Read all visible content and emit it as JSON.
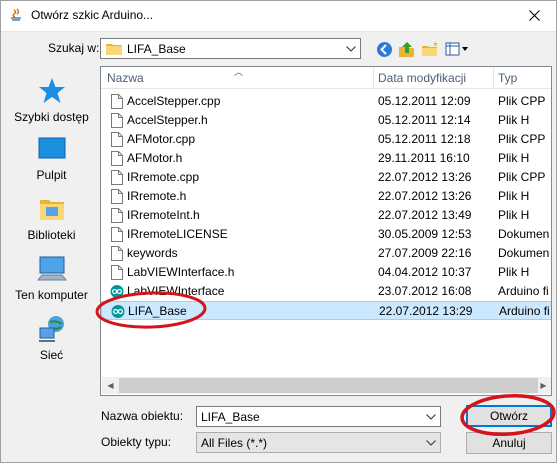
{
  "window": {
    "title": "Otwórz szkic Arduino..."
  },
  "toolbar": {
    "look_in_label": "Szukaj w:",
    "look_in_value": "LIFA_Base",
    "icons": [
      "back-icon",
      "up-folder-icon",
      "new-folder-icon",
      "view-menu-icon"
    ]
  },
  "places": [
    {
      "label": "Szybki dostęp",
      "icon": "star-icon"
    },
    {
      "label": "Pulpit",
      "icon": "desktop-icon"
    },
    {
      "label": "Biblioteki",
      "icon": "libraries-icon"
    },
    {
      "label": "Ten komputer",
      "icon": "computer-icon"
    },
    {
      "label": "Sieć",
      "icon": "network-icon"
    }
  ],
  "filelist": {
    "columns": {
      "name": "Nazwa",
      "date": "Data modyfikacji",
      "type": "Typ"
    },
    "rows": [
      {
        "name": "AccelStepper.cpp",
        "date": "05.12.2011 12:09",
        "type": "Plik CPP",
        "icon": "file-icon"
      },
      {
        "name": "AccelStepper.h",
        "date": "05.12.2011 12:14",
        "type": "Plik H",
        "icon": "file-icon"
      },
      {
        "name": "AFMotor.cpp",
        "date": "05.12.2011 12:18",
        "type": "Plik CPP",
        "icon": "file-icon"
      },
      {
        "name": "AFMotor.h",
        "date": "29.11.2011 16:10",
        "type": "Plik H",
        "icon": "file-icon"
      },
      {
        "name": "IRremote.cpp",
        "date": "22.07.2012 13:26",
        "type": "Plik CPP",
        "icon": "file-icon"
      },
      {
        "name": "IRremote.h",
        "date": "22.07.2012 13:26",
        "type": "Plik H",
        "icon": "file-icon"
      },
      {
        "name": "IRremoteInt.h",
        "date": "22.07.2012 13:49",
        "type": "Plik H",
        "icon": "file-icon"
      },
      {
        "name": "IRremoteLICENSE",
        "date": "30.05.2009 12:53",
        "type": "Dokumen",
        "icon": "file-icon"
      },
      {
        "name": "keywords",
        "date": "27.07.2009 22:16",
        "type": "Dokumen",
        "icon": "file-icon"
      },
      {
        "name": "LabVIEWInterface.h",
        "date": "04.04.2012 10:37",
        "type": "Plik H",
        "icon": "file-icon"
      },
      {
        "name": "LabVIEWInterface",
        "date": "23.07.2012 16:08",
        "type": "Arduino fi",
        "icon": "arduino-icon"
      },
      {
        "name": "LIFA_Base",
        "date": "22.07.2012 13:29",
        "type": "Arduino fi",
        "icon": "arduino-icon",
        "selected": true
      }
    ]
  },
  "form": {
    "object_name_label": "Nazwa obiektu:",
    "object_name_value": "LIFA_Base",
    "object_type_label": "Obiekty typu:",
    "object_type_value": "All Files (*.*)",
    "open_button": "Otwórz",
    "cancel_button": "Anuluj"
  },
  "colors": {
    "selection": "#cce8ff",
    "annotation": "#d4141b",
    "accent": "#0078d7"
  }
}
